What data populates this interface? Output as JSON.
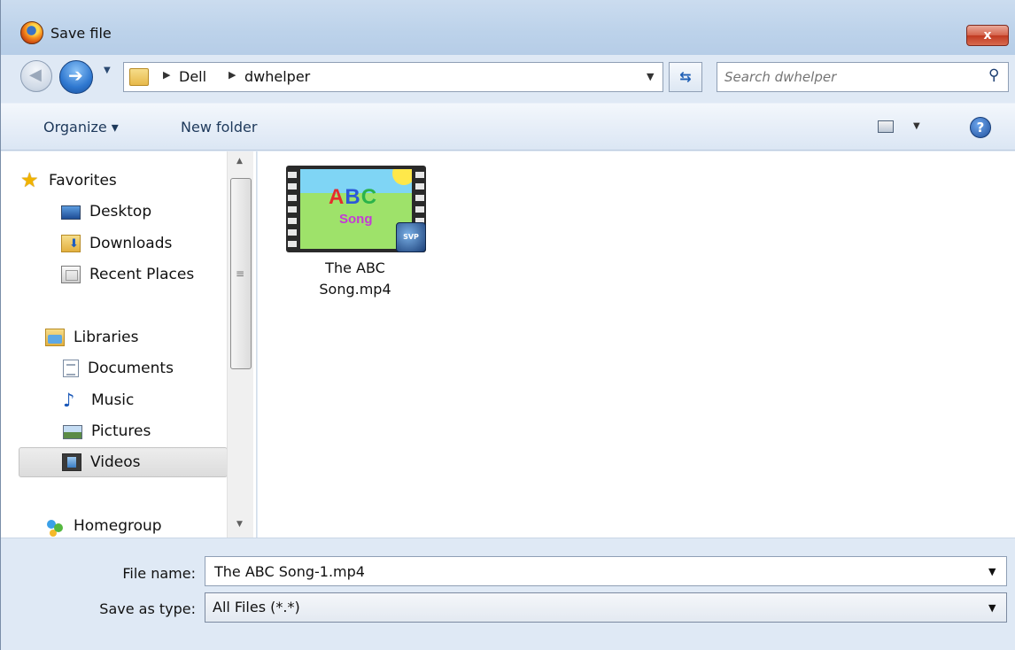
{
  "window": {
    "title": "Save file",
    "close_label": "x"
  },
  "address": {
    "breadcrumbs": [
      "Dell",
      "dwhelper"
    ],
    "search_placeholder": "Search dwhelper"
  },
  "toolbar": {
    "organize_label": "Organize ▾",
    "new_folder_label": "New folder"
  },
  "nav": {
    "favorites": "Favorites",
    "desktop": "Desktop",
    "downloads": "Downloads",
    "recent": "Recent Places",
    "libraries": "Libraries",
    "documents": "Documents",
    "music": "Music",
    "pictures": "Pictures",
    "videos": "Videos",
    "homegroup": "Homegroup",
    "selected": "Videos"
  },
  "files": [
    {
      "name_line1": "The ABC",
      "name_line2": "Song.mp4",
      "thumb_title_a": "A",
      "thumb_title_b": "B",
      "thumb_title_c": "C",
      "thumb_song": "Song",
      "thumb_badge": "SVP"
    }
  ],
  "form": {
    "file_name_label": "File name:",
    "file_name_value": "The ABC Song-1.mp4",
    "save_type_label": "Save as type:",
    "save_type_value": "All Files (*.*)"
  },
  "colors": {
    "chrome": "#dfe9f5",
    "close": "#c03a21",
    "accent": "#2f78d0"
  }
}
